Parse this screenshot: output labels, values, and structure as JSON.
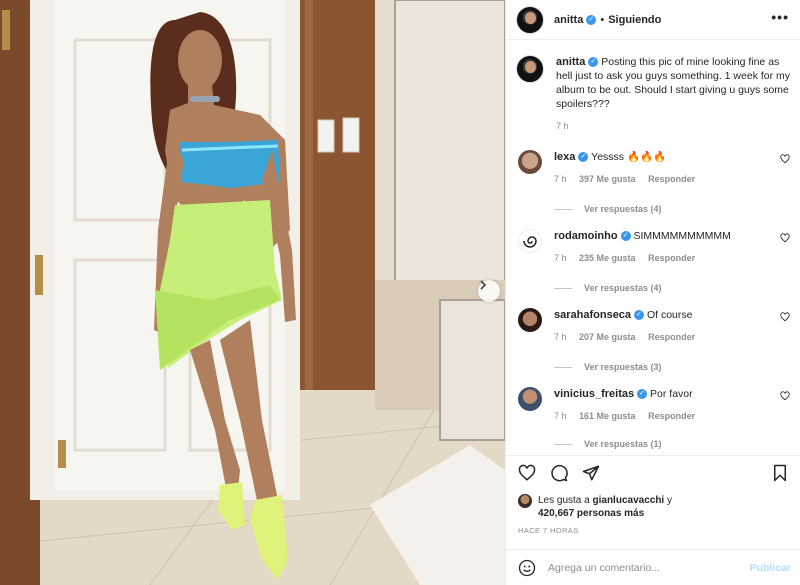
{
  "header": {
    "username": "anitta",
    "dot": "•",
    "following_label": "Siguiendo",
    "more_label": "•••"
  },
  "caption": {
    "username": "anitta",
    "text": "Posting this pic of mine looking fine as hell just to ask you guys something. 1 week for my album to be out. Should I start giving u guys some spoilers???",
    "time": "7 h"
  },
  "comments": [
    {
      "username": "lexa",
      "text": "Yessss 🔥🔥🔥",
      "time": "7 h",
      "likes": "397 Me gusta",
      "reply_label": "Responder",
      "replies": "Ver respuestas (4)",
      "avatar_color": "#c9a48d"
    },
    {
      "username": "rodamoinho",
      "text": "SIMMMMMMMMMM",
      "time": "7 h",
      "likes": "235 Me gusta",
      "reply_label": "Responder",
      "replies": "Ver respuestas (4)",
      "avatar_color": "#ffffff"
    },
    {
      "username": "sarahafonseca",
      "text": "Of course",
      "time": "7 h",
      "likes": "207 Me gusta",
      "reply_label": "Responder",
      "replies": "Ver respuestas (3)",
      "avatar_color": "#5a3a2e"
    },
    {
      "username": "vinicius_freitas",
      "text": "Por favor",
      "time": "7 h",
      "likes": "161 Me gusta",
      "reply_label": "Responder",
      "replies": "Ver respuestas (1)",
      "avatar_color": "#3c4f6b"
    }
  ],
  "likes": {
    "prefix": "Les gusta a",
    "user": "gianlucavacchi",
    "conjunction": "y",
    "count": "420,667 personas más"
  },
  "time_ago": "HACE 7 HORAS",
  "comment_box": {
    "placeholder": "Agrega un comentario...",
    "publish_label": "Publicar"
  },
  "colors": {
    "verified": "#3897f0",
    "publish_disabled": "#b2dffc",
    "muted": "#8e8e8e"
  }
}
